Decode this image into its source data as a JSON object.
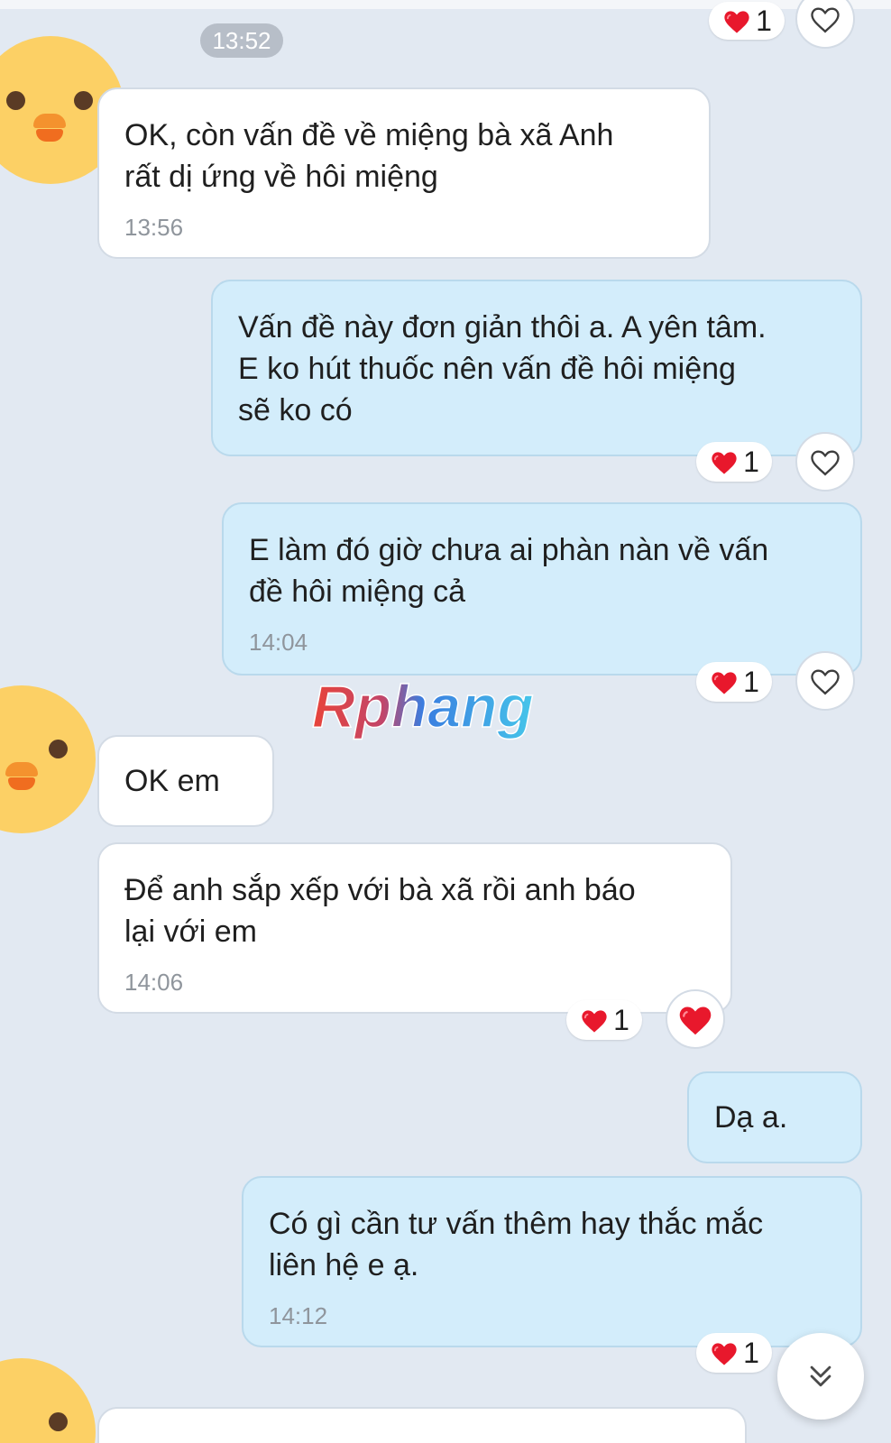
{
  "chat": {
    "date_pill": "13:52",
    "messages": [
      {
        "text": "OK, còn vấn đề về miệng bà xã Anh\nrất dị ứng về hôi miệng",
        "time": "13:56"
      },
      {
        "text": "Vấn đề này đơn giản thôi a. A yên tâm.\nE ko hút thuốc nên vấn đề hôi miệng\nsẽ ko có",
        "reaction_count": "1"
      },
      {
        "text": "E làm đó giờ chưa ai phàn nàn về vấn\nđề hôi miệng cả",
        "time": "14:04",
        "reaction_count": "1"
      },
      {
        "text": "OK em"
      },
      {
        "text": "Để anh sắp xếp với bà xã rồi anh báo\nlại với em",
        "time": "14:06",
        "reaction_count": "1"
      },
      {
        "text": "Dạ a."
      },
      {
        "text": "Có gì cần tư vấn thêm hay thắc mắc\nliên hệ e ạ.",
        "time": "14:12",
        "reaction_count": "1"
      }
    ],
    "top_reaction_count": "1"
  },
  "watermark": {
    "text": "Rphang",
    "colors": [
      "#e8443a",
      "#3a7de0"
    ]
  },
  "icons": {
    "heart": "heart-icon",
    "heart_outline": "heart-outline-icon",
    "scroll_down": "double-chevron-down-icon",
    "avatar": "duck-avatar"
  },
  "colors": {
    "background": "#e2e9f2",
    "incoming_bubble": "#ffffff",
    "outgoing_bubble": "#d3edfb",
    "heart": "#e8182c",
    "avatar": "#fcd065"
  }
}
